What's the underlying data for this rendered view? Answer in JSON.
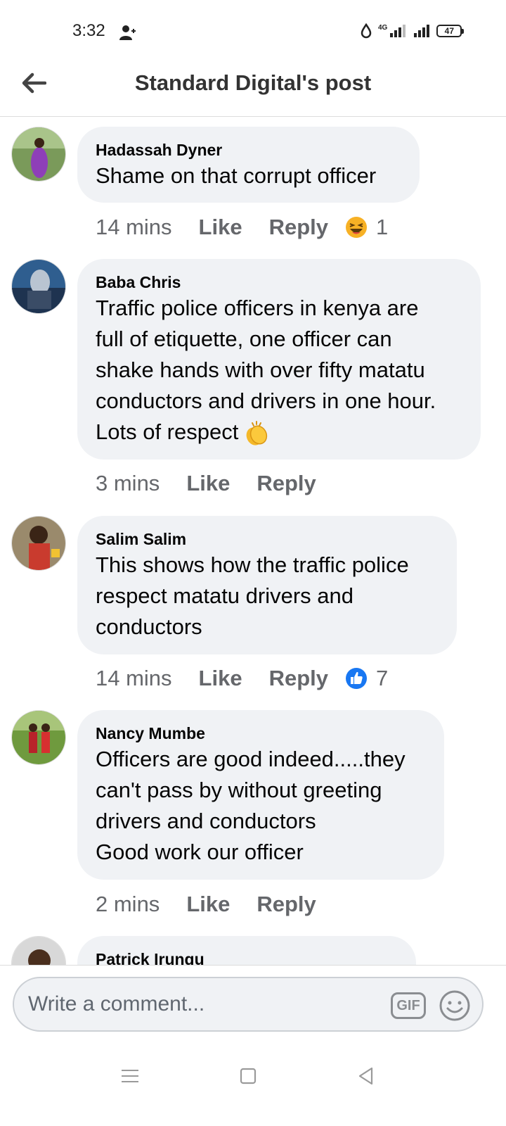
{
  "status_bar": {
    "time": "3:32",
    "network": "4G",
    "battery": "47"
  },
  "header": {
    "title": "Standard Digital's post"
  },
  "comments": [
    {
      "author": "Hadassah Dyner",
      "text": "Shame on that corrupt officer",
      "time": "14 mins",
      "like": "Like",
      "reply": "Reply",
      "reaction_icon": "laugh-emoji",
      "reaction_count": "1"
    },
    {
      "author": "Baba Chris",
      "text": "Traffic police officers in kenya are\nfull of etiquette, one officer can\nshake hands with over fifty matatu\nconductors and drivers in one hour.\nLots of respect",
      "inline_emoji": "clapping-hands-emoji",
      "time": "3 mins",
      "like": "Like",
      "reply": "Reply"
    },
    {
      "author": "Salim Salim",
      "text": "This shows how the traffic police\nrespect matatu drivers and\nconductors",
      "time": "14 mins",
      "like": "Like",
      "reply": "Reply",
      "reaction_icon": "thumbs-up-icon",
      "reaction_count": "7"
    },
    {
      "author": "Nancy Mumbe",
      "text": "Officers are good indeed.....they\ncan't pass by without greeting\ndrivers and conductors\nGood work our officer",
      "time": "2 mins",
      "like": "Like",
      "reply": "Reply"
    },
    {
      "author": "Patrick Irungu"
    }
  ],
  "composer": {
    "placeholder": "Write a comment...",
    "gif_label": "GIF"
  },
  "colors": {
    "bubble": "#f0f2f5",
    "meta_text": "#65676b",
    "like_blue": "#1877f2"
  }
}
